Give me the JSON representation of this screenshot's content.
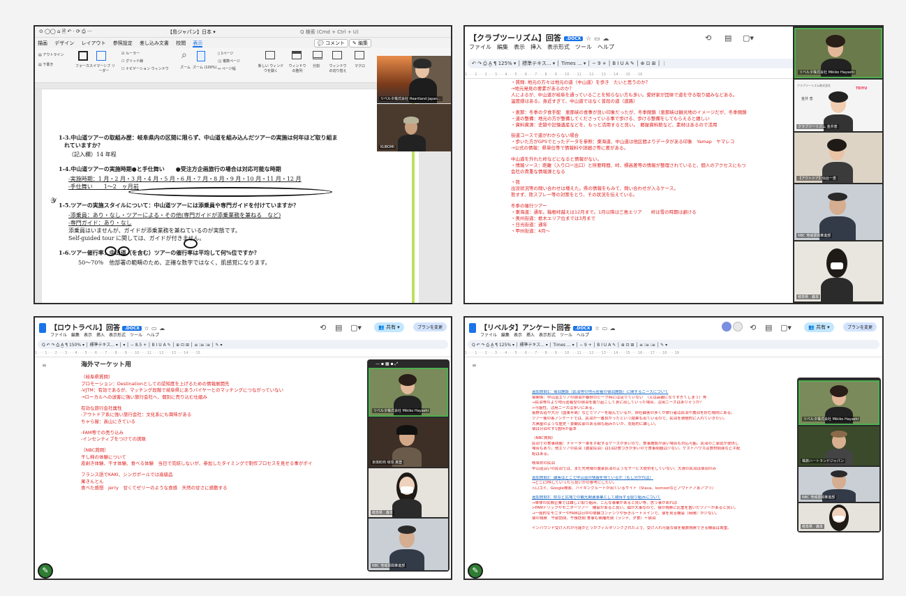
{
  "p1": {
    "qat": "⊙ ◯◯ ⌂ 🗎 ↶ · ⟳ ⎙ ···",
    "title": "【島ジャパン】日本 ▾",
    "search": "Q 検索 (Cmd + Ctrl + U)",
    "tabs": [
      "描画",
      "デザイン",
      "レイアウト",
      "参照設定",
      "差し込み文書",
      "校閲",
      "表示"
    ],
    "ribbon": {
      "a": "アウトライン",
      "b": "下書き",
      "c": "フォーカス",
      "d": "イマーシブ リーダー",
      "e": "ルーラー",
      "f": "グリッド線",
      "g": "ナビゲーション ウィンドウ",
      "h": "ズーム",
      "i": "ズーム (100%)",
      "j": "1ページ",
      "k": "複数ページ",
      "l": "ページ幅",
      "m": "新しい ウィンドウを開く",
      "n": "ウィンドウ の整列",
      "o": "分割",
      "p": "ウィンドウ の切り替え",
      "q": "マクロ"
    },
    "comment": "コメント",
    "edit": "編集",
    "video": [
      "リベルタ株式会社 Heartland Japan...",
      "KUBOMI"
    ],
    "doc": [
      "1-3.中山道ツアーの取組み歴：岐阜県内の区間に限らず、中山道を組み込んだツアーの実施は何年ほど取り組ま",
      "れていますか？",
      "（記入欄）14 年程",
      "1-4.中山道ツアーの実施時期●と手仕舞い　　●受注方企画旅行の場合は対応可能な時期",
      "-実施時期：1 月・2 月・3 月・4 月・5 月・6 月・7 月・8 月・9 月・10 月・11 月・12 月",
      "-手仕舞い　　1～2　ヶ月前",
      "1-5.ツアーの実施スタイルについて：中山道ツアーには添乗員や専門ガイドを付けていますか？",
      "-添乗員：あり・なし・ツアーによる・その他(専門ガイドが添乗業務を兼ねる　など)",
      "-専門ガイド：あり・なし",
      "添乗員はいませんが、ガイドが添乗業務を兼ねているのが実態です。",
      "Self-guided tour に関しては、ガイドが付きません。",
      "1-6.ツアー催行率：中山道（を含む）ツアーの催行率は平均して何%位ですか？",
      "50～70％　他部署の範疇のため、正確な数字ではなく、肌感覚になります。"
    ]
  },
  "p2": {
    "title": "【クラブツーリズム】回答",
    "badge": ".DOCX",
    "menu": "ファイル　編集　表示　挿入　表示形式　ツール　ヘルプ",
    "toolbar": "↶ ↷ ⎙ A̲ ¶  125% ▾ │ 標準テキス... ▾ │ Times ... ▾ │ − 9 + │ B I U A ✎ │ ⊕ ⊡ ⊞ │ ⋮",
    "ruler": "1 · · · 1 · · · 2 · · · 3 · · · 4 · · · 5 · · · 6 · · · 7 · · · 8 · · · 9 · · · 10 · · · 11 · · · 12 · · · 13 · · · 14 · · · 15 · · · 16",
    "lines": [
      "・質問: 地元の方々は地元の道（中山道）を歩き　たいと思うのか？",
      "→地元発見の要素があるのか？",
      "人によるが、中山道が岐阜を通っていることを知らない方も多い。愛好家が団体で道を守る取り組みなどある。",
      "温度感はある。身近すぎて、中山道ではなく普段の道（道路）",
      "",
      "・恵那：冬季の夕食手配　恵那峡の食事が良い印象だったが、冬季閉鎖（恵那峡は観光地のイメージだが、冬季閉鎖",
      "・道の整備：地元の方が整備してくださっている事で歩ける、歩ける整備をしてもらえると嬉しい",
      "・資料資源：史跡や記憶遺産などを、もっと活用すると良い。　郷屋資料館など、素材はあるので活用",
      "",
      "街道コースで道がわからない場合",
      "・歩いた方がGPSでとったデータを参照：東海道、中山道は他区間よりデータがある印象　Yamap　ヤマレコ",
      "→公式の情報：県単位等で情報料や詳細さ等に差がある。",
      "",
      "中山道を外れた峠などになると情報がない。",
      "・情報ソース：距離（入り口ー出口）と所要時間、峠、標高差等の情報が整理されていると、個人のアクセスにもつ",
      "会社の貴重な情報源となる",
      "",
      "・熊",
      "出没状況等の問い合わせは増えた。県の情報をもみて、問い合わせが入るケース。",
      "熊すず、熊スプレー等の対策をとり、その状況を伝えている。",
      "",
      "冬季の催行ツアー",
      "・東海道：通年。箱根峠越えは12月まで。1月以降は三島エリア　　峠は雪の時期は避ける",
      "・奥州街道：栃木エリア位までは3月まで",
      "・日光街道：通年",
      "・甲州街道：4月～"
    ],
    "video": [
      "リベルタ株式会社 Mikiko Hayashi",
      "クラブツーリズム 金井恵",
      "【アウトドア】仙台一恵",
      "NBC 地域振興推進部",
      "岐阜県　森本"
    ],
    "slide": {
      "top": "クラブツーリズム株式会社",
      "mid": "TEIYU",
      "bot": "金井 恵"
    }
  },
  "p3": {
    "title": "【ロウトラベル】回答",
    "badge": ".DOCX",
    "menu": "ファイル　編集　表示　挿入　表示形式　ツール　ヘルプ",
    "toolbar": "Q ↶ ↷ ⎙ A̲ ¶  150% ▾ │ 標準テキス... ▾ │ ▾ │ − 8.5 + │ B I U A ✎ │ ⊕ ⊡ ⊞ │ ≡ ⁝≡ ⁝≡ │ ✎ ▾",
    "share": "共有",
    "plan": "プランを変更",
    "ruler": "1 · · · 1 · · · 2 · · · 3 · · · 4 · · · 5 · · · 6 · · · 7 · · · 8 · · · 9 · · · 10 · · · 11 · · · 12 · · · 13 · · · 14 · · · 15",
    "heading": "海外マーケット用",
    "lines": [
      "（岐阜県質問）",
      "プロモーション：Destinationとしての認知度を上げるための情報展開先",
      "-VJTM：有効であるが、マッチング段階で岐阜県にあうバイヤーとのマッチングにつながっていない",
      "→ローカルへの送客に強い旅行会社へ、個別に売り込む仕組み",
      "",
      "有効な旅行会社属性",
      "-アウトドア系に強い旅行会社：文化系にも興味がある",
      "ちゃら屋：高山にきている",
      "",
      "-FAM等での売り込み",
      "-インセンティブをつけての誘致",
      "",
      "（NBC質問）",
      "干し柿の体験について",
      "皮剥き体験、干す体験、食べる体験　当日で完結しないが、参加したタイミングで制作プロセスを見せる事がポイ",
      "",
      "フランス語でKAKI、シンガポールでは高級品",
      "果きんとん",
      "食べた感想　jerry　甘くてゼリーのような食感　天然の甘さに感動する"
    ],
    "video": [
      "リベルタ株式会社 Mikiko Hayashi",
      "京体町商 岐阜 真登",
      "岐阜県　森本",
      "NBC 地域振興推進部"
    ]
  },
  "p4": {
    "title": "【リベルタ】アンケート回答",
    "badge": ".DOCX",
    "menu": "ファイル　編集　表示　挿入　表示形式　ツール　ヘルプ",
    "toolbar": "Q ↶ ↷ ⎙ A̲ ¶  125% ▾ │ 標準テキス... ▾ │ Times ... ▾ │ − 9 + │ B I U A ✎ │ ⊕ ⊡ ⊞ │ ≡ ⁝≡ ⁝≡ │ ✎ ▾",
    "share": "共有",
    "plan": "プランを変更",
    "ruler": "1 · · · 1 · · · 2 · · · 3 · · · 4 · · · 5 · · · 6 · · · 7 · · · 8 · · · 9 · · · 10 · · · 11 · · · 12 · · · 13 · · · 14 · · · 15 · · · 16 · · · 17 · · · 18 · · · 19",
    "lines": [
      {
        "t": "追加質問1：宿泊施設（民泊等の地元密着の宿泊施設）に関するニーズについて",
        "c": "blu"
      },
      {
        "t": "宿関係：中山道エリアの宿泊が春秋のピーク時には足りていない　（又は高額になりすぎてしまう）等",
        "c": "red"
      },
      {
        "t": "→民泊等のより地元密着型の宿泊を掘り起こして表に出していった場合、活用ニーズはありそうか？",
        "c": "red"
      },
      {
        "t": ">可能性、活用ニーズは多いにある。",
        "c": "red"
      },
      {
        "t": "長野古道や大分（国東半島）などでツアーを組んでいるが、自社顧客の多くが旅行者は民泊や農泊を好む傾向にある。",
        "c": "red"
      },
      {
        "t": "ツアー後の客アンケートでは、民泊が一番良かったという結果も出ているので、民泊を積極的に入れていきたい。",
        "c": "red"
      },
      {
        "t": "大黒屋のような歴史・景観民家のある宿も組みたいが、支配的に難しい。",
        "c": "red"
      },
      {
        "t": "宿は分泊せず1箇所が基本",
        "c": "red"
      },
      {
        "t": "",
        "c": "red"
      },
      {
        "t": "（NBC質問）",
        "c": "red"
      },
      {
        "t": "民泊での食事問題：チャーター車を手配するケースが多いので、食事施設が遠い場合も対応可能。民泊のご家庭が提供し",
        "c": "red"
      },
      {
        "t": "場合もあり。他エリアの民泊（農家民泊）は1泊2食つきが多いので食事問題は少ない。ゲストハウスは食材調達など手配",
        "c": "red"
      },
      {
        "t": "配はある。",
        "c": "red"
      },
      {
        "t": "",
        "c": "red"
      },
      {
        "t": "岐阜県の民泊",
        "c": "red"
      },
      {
        "t": "中山道沿いの民泊では、まだ先地域の農家民泊のようなサービス提供をしていない。大湫の民泊は宿泊のみ",
        "c": "red"
      },
      {
        "t": "",
        "c": "red"
      },
      {
        "t": "追加質問2：顧客はどこで中山道の情報を得ているか（もし分かれば）",
        "c": "blu"
      },
      {
        "t": "→どこにPRしていったら良いかの参考にしたい。",
        "c": "red"
      },
      {
        "t": ">口コミ、Google検索、ハイキングルートが出ているサイト（Stava、komootなどアウトドア系アプリ）",
        "c": "red"
      },
      {
        "t": "",
        "c": "red"
      },
      {
        "t": "追加質問3：県など広域での観光関連事業として期待する取り組みについて",
        "c": "blu"
      },
      {
        "t": "→単体の民間企業では難しい取り組み、こんな事業があると良い等、思う事があれば",
        "c": "red"
      },
      {
        "t": ">FAMトリップやモニターツアー　機会があると良い。個が大事なので、宿の視察に比重を置いたツアーがあると良い。",
        "c": "red"
      },
      {
        "t": "→一般的なモニターやFAMは日中の体験コンテンツや歩きルートメインで、宿を見る機会（時間）が少ない。",
        "c": "red"
      },
      {
        "t": "宿の視察　午前訪問、午後訪問 食事も候補先宿（ランチ、夕食）＋宿泊",
        "c": "red"
      },
      {
        "t": "",
        "c": "red"
      },
      {
        "t": "インバウンド受け入れが可能かどうかフィルタリングされた上で、受け入れ可能な宿を複数視察できる機会は貴重。",
        "c": "red"
      }
    ],
    "video": [
      "リベルタ株式会社 Mikiko Hayashi",
      "株旅ハートランドジャパン",
      "NBC 地域振興推進部",
      "岐阜県　森本"
    ]
  }
}
